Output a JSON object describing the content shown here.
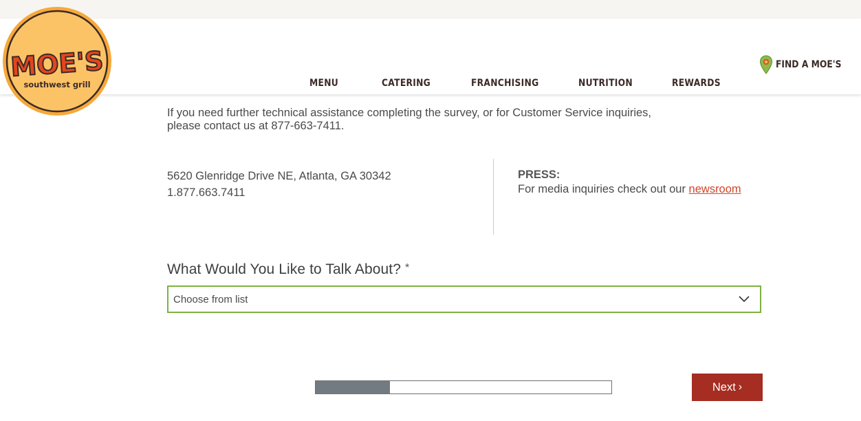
{
  "brand": {
    "logo_text": "MOE'S",
    "logo_subtext": "southwest grill"
  },
  "nav": {
    "menu": "MENU",
    "catering": "CATERING",
    "franchising": "FRANCHISING",
    "nutrition": "NUTRITION",
    "rewards": "REWARDS",
    "find": "FIND A MOE'S"
  },
  "info": {
    "line1": "If you need further technical assistance completing the survey, or for Customer Service inquiries,",
    "line2": "please contact us at 877-663-7411."
  },
  "address": {
    "street": "5620 Glenridge Drive NE, Atlanta, GA 30342",
    "phone": "1.877.663.7411"
  },
  "press": {
    "title": "PRESS:",
    "text": "For media inquiries check out our",
    "link": "newsroom"
  },
  "form": {
    "question": "What Would You Like to Talk About?",
    "required_marker": "*",
    "select_value": "Choose from list",
    "progress_fraction": 0.25,
    "next_label": "Next"
  },
  "colors": {
    "accent_green": "#7db141",
    "button_red": "#a52d22",
    "link_red": "#d2462a",
    "progress_fill": "#737b82"
  }
}
